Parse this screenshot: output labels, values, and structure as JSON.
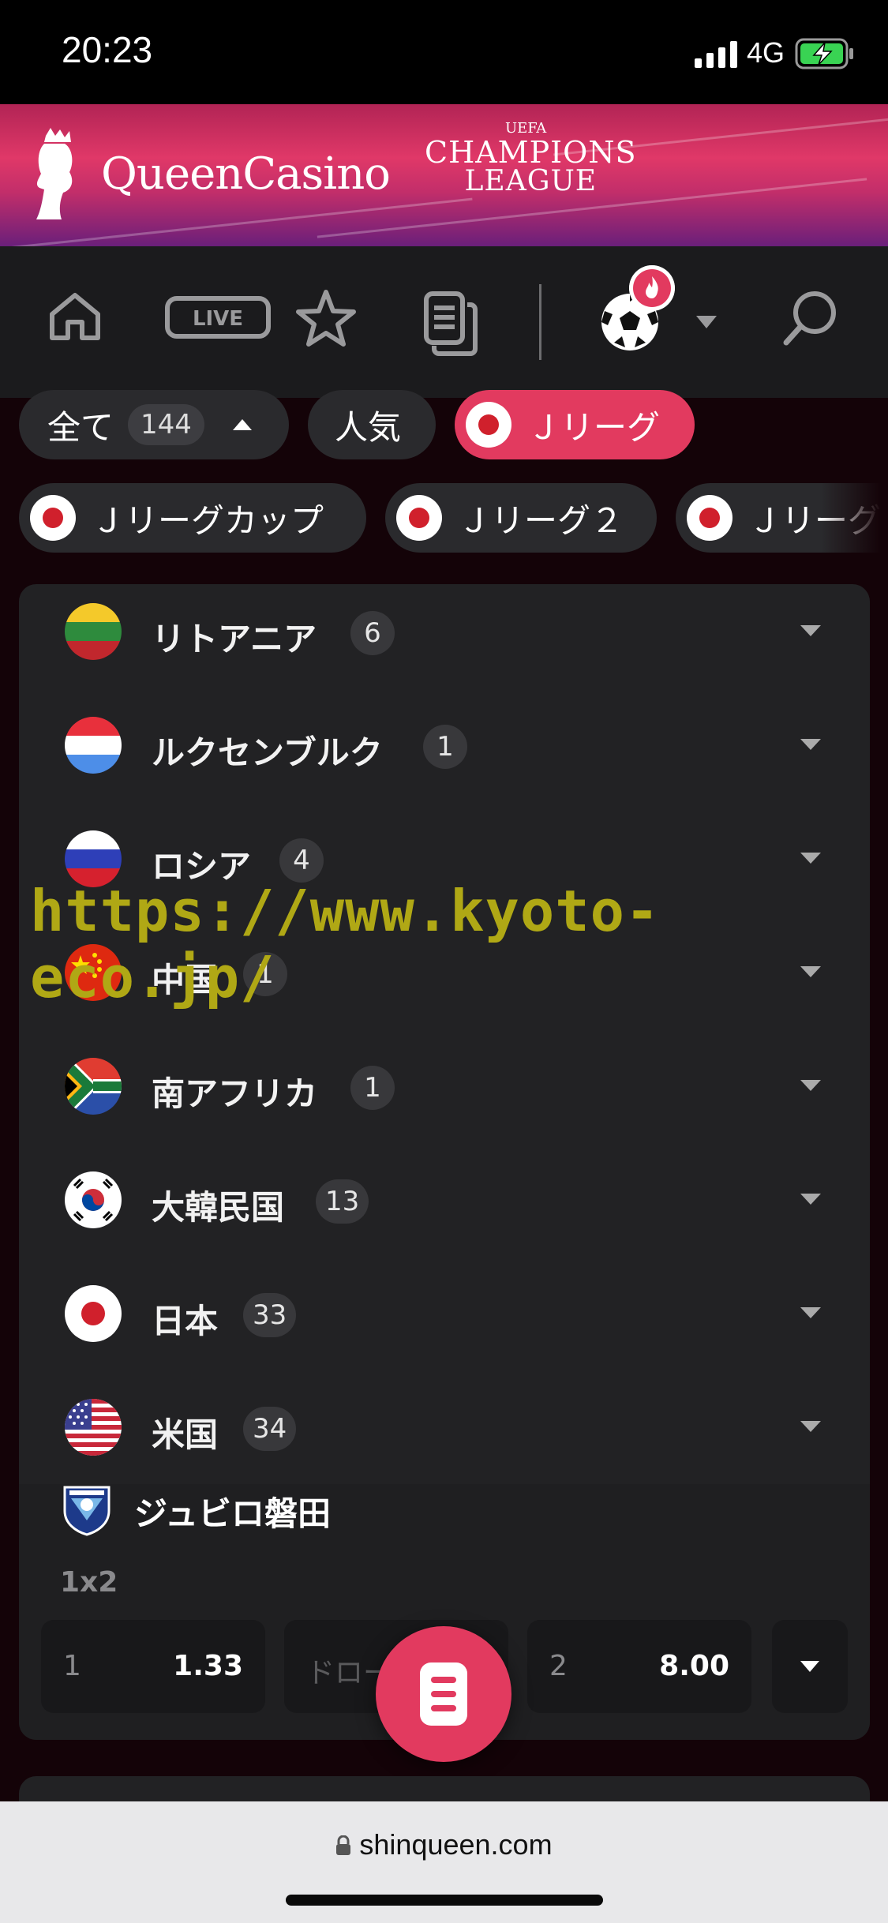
{
  "status_bar": {
    "time": "20:23",
    "network": "4G"
  },
  "banner": {
    "brand": "QueenCasino",
    "partner_line1": "CHAMPIONS",
    "partner_line2": "LEAGUE",
    "partner_small": "UEFA"
  },
  "nav": {
    "icons": [
      "home-icon",
      "live-icon",
      "star-icon",
      "betslip-icon",
      "soccer-ball-icon",
      "search-icon"
    ],
    "live_label": "LIVE"
  },
  "filters": {
    "row1": [
      {
        "label": "全て",
        "count": "144"
      },
      {
        "label": "人気"
      },
      {
        "label": "Ｊリーグ",
        "active": true
      }
    ],
    "row2": [
      {
        "label": "Ｊリーグカップ"
      },
      {
        "label": "Ｊリーグ２"
      },
      {
        "label": "Ｊリーグ"
      }
    ]
  },
  "countries": [
    {
      "name": "リトアニア",
      "count": "6"
    },
    {
      "name": "ルクセンブルク",
      "count": "1"
    },
    {
      "name": "ロシア",
      "count": "4"
    },
    {
      "name": "中国",
      "count": "1"
    },
    {
      "name": "南アフリカ",
      "count": "1"
    },
    {
      "name": "大韓民国",
      "count": "13"
    },
    {
      "name": "日本",
      "count": "33"
    },
    {
      "name": "米国",
      "count": "34"
    }
  ],
  "match": {
    "team": "ジュビロ磐田",
    "market": "1x2",
    "odds": [
      {
        "key": "1",
        "value": "1.33"
      },
      {
        "key": "ドロー",
        "value": ""
      },
      {
        "key": "2",
        "value": "8.00"
      }
    ]
  },
  "watermark": "https://www.kyoto-eco.jp/",
  "browser": {
    "url": "shinqueen.com"
  },
  "colors": {
    "accent": "#e23a5f",
    "panel": "#222224",
    "nav": "#1b1b1d"
  }
}
